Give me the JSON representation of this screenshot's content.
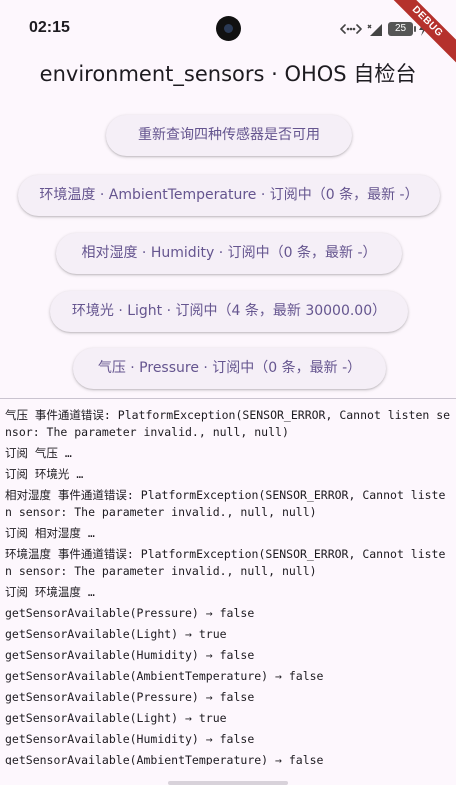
{
  "status_bar": {
    "time": "02:15",
    "battery_level": "25",
    "icons": [
      "link-arrows-icon",
      "wifi-x-icon",
      "battery-icon",
      "charging-bolt-icon"
    ]
  },
  "debug_banner": "DEBUG",
  "title": "environment_sensors · OHOS 自检台",
  "buttons": {
    "query": "重新查询四种传感器是否可用",
    "ambient_temperature": "环境温度 · AmbientTemperature · 订阅中（0 条，最新 -）",
    "humidity": "相对湿度 · Humidity · 订阅中（0 条，最新 -）",
    "light": "环境光 · Light · 订阅中（4 条，最新 30000.00）",
    "pressure": "气压 · Pressure · 订阅中（0 条，最新 -）"
  },
  "log": [
    "气压 事件通道错误: PlatformException(SENSOR_ERROR, Cannot listen sensor: The parameter invalid., null, null)",
    "订阅 气压 …",
    "订阅 环境光 …",
    "相对湿度 事件通道错误: PlatformException(SENSOR_ERROR, Cannot listen sensor: The parameter invalid., null, null)",
    "订阅 相对湿度 …",
    "环境温度 事件通道错误: PlatformException(SENSOR_ERROR, Cannot listen sensor: The parameter invalid., null, null)",
    "订阅 环境温度 …",
    "getSensorAvailable(Pressure) → false",
    "getSensorAvailable(Light) → true",
    "getSensorAvailable(Humidity) → false",
    "getSensorAvailable(AmbientTemperature) → false",
    "getSensorAvailable(Pressure) → false",
    "getSensorAvailable(Light) → true",
    "getSensorAvailable(Humidity) → false",
    "getSensorAvailable(AmbientTemperature) → false"
  ],
  "colors": {
    "background": "#fdf7fd",
    "button_bg": "#f5eff7",
    "button_text": "#65558f",
    "debug_ribbon": "#b5312c"
  }
}
